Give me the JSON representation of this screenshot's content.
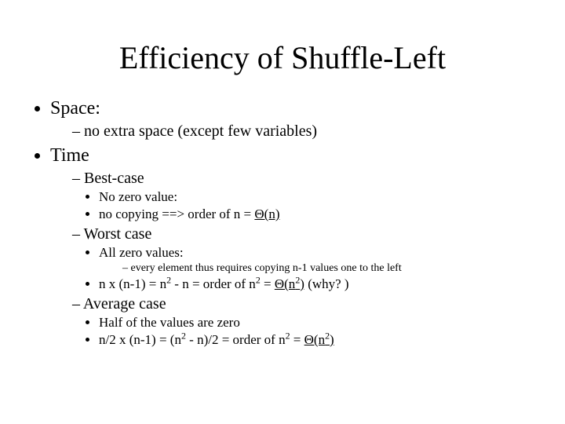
{
  "title": "Efficiency of Shuffle-Left",
  "space": {
    "label": "Space:",
    "sub1": "no extra space (except few variables)"
  },
  "time": {
    "label": "Time",
    "best": {
      "label": "Best-case",
      "p1": "No zero value:",
      "p2a": " no copying  ==> order of n = ",
      "p2b": "Θ(n)"
    },
    "worst": {
      "label": "Worst case",
      "p1": "All zero values:",
      "p1a": " every element thus requires copying n-1 values one to the left",
      "p2a": "n x (n-1) = n",
      "p2b": " - n = order of n",
      "p2c": " = ",
      "p2d": "Θ(n",
      "p2e": ")",
      "p2f": " (why? )"
    },
    "avg": {
      "label": "Average case",
      "p1": "Half of the values are zero",
      "p2a": "n/2 x (n-1) = (n",
      "p2b": " - n)/2 = order of n",
      "p2c": " = ",
      "p2d": "Θ(n",
      "p2e": ")"
    }
  },
  "exp2": "2"
}
